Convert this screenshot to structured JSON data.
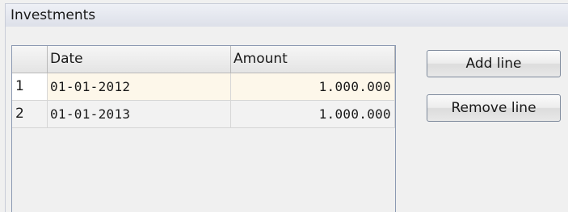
{
  "group": {
    "title": "Investments"
  },
  "grid": {
    "columns": [
      "",
      "Date",
      "Amount"
    ],
    "rows": [
      {
        "index": "1",
        "date": "01-01-2012",
        "amount": "1.000.000"
      },
      {
        "index": "2",
        "date": "01-01-2013",
        "amount": "1.000.000"
      }
    ]
  },
  "buttons": {
    "add_label": "Add line",
    "remove_label": "Remove line"
  },
  "colors": {
    "selected_row": "#fdf7ea",
    "grid_border": "#8c9ab3"
  }
}
